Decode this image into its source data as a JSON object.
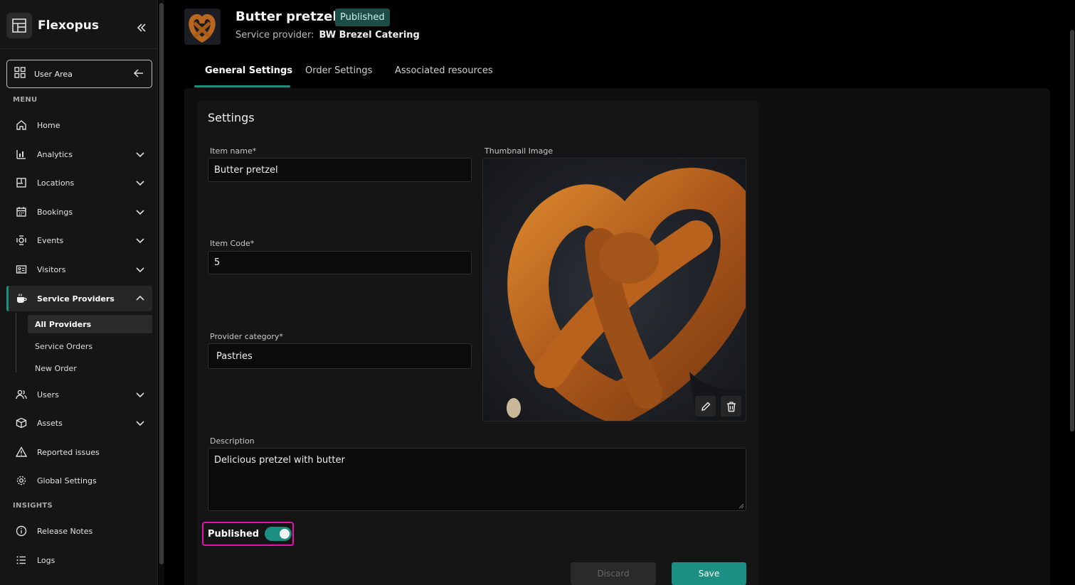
{
  "brand": {
    "name": "Flexopus"
  },
  "user_area": {
    "label": "User Area"
  },
  "sections": {
    "menu": "MENU",
    "insights": "INSIGHTS"
  },
  "nav": {
    "home": "Home",
    "analytics": "Analytics",
    "locations": "Locations",
    "bookings": "Bookings",
    "events": "Events",
    "visitors": "Visitors",
    "service_providers": "Service Providers",
    "all_providers": "All Providers",
    "service_orders": "Service Orders",
    "new_order": "New Order",
    "users": "Users",
    "assets": "Assets",
    "reported_issues": "Reported issues",
    "global_settings": "Global Settings",
    "release_notes": "Release Notes",
    "logs": "Logs"
  },
  "header": {
    "title": "Butter pretzel",
    "status": "Published",
    "provider_label": "Service provider:",
    "provider_name": "BW Brezel Catering"
  },
  "tabs": [
    "General Settings",
    "Order Settings",
    "Associated resources"
  ],
  "settings": {
    "title": "Settings",
    "item_name_label": "Item name*",
    "item_name_value": "Butter pretzel",
    "item_code_label": "Item Code*",
    "item_code_value": "5",
    "category_label": "Provider category*",
    "category_value": "Pastries",
    "thumbnail_label": "Thumbnail Image",
    "description_label": "Description",
    "description_value": "Delicious pretzel with butter",
    "published_label": "Published",
    "published_on": true
  },
  "actions": {
    "discard": "Discard",
    "save": "Save"
  },
  "colors": {
    "accent": "#1a8f82",
    "highlight": "#e414a8",
    "background": "#000000"
  }
}
